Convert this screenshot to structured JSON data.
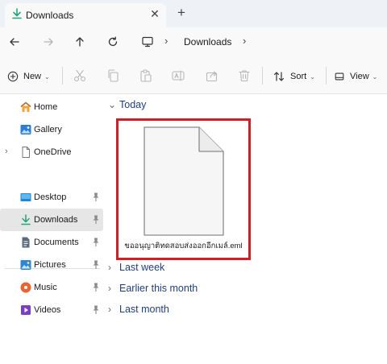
{
  "tab": {
    "title": "Downloads",
    "close_glyph": "✕",
    "new_tab_glyph": "+"
  },
  "navigation": {
    "back": "←",
    "forward": "→",
    "up": "↑",
    "refresh": "↻"
  },
  "address_bar": {
    "separator": "›",
    "path": "Downloads"
  },
  "toolbar": {
    "new_label": "New",
    "sort_label": "Sort",
    "view_label": "View",
    "caret": "⌄"
  },
  "sidebar": {
    "quick": [
      {
        "label": "Home",
        "icon": "home-icon"
      },
      {
        "label": "Gallery",
        "icon": "gallery-icon"
      },
      {
        "label": "OneDrive",
        "icon": "file-icon",
        "expand": "›"
      }
    ],
    "pinned": [
      {
        "label": "Desktop",
        "icon": "desktop-icon",
        "color": "#1e88d3"
      },
      {
        "label": "Downloads",
        "icon": "download-icon",
        "color": "#21a47a",
        "selected": true
      },
      {
        "label": "Documents",
        "icon": "documents-icon",
        "color": "#5b6b7c"
      },
      {
        "label": "Pictures",
        "icon": "pictures-icon",
        "color": "#2f86d6"
      },
      {
        "label": "Music",
        "icon": "music-icon",
        "color": "#e86534"
      },
      {
        "label": "Videos",
        "icon": "videos-icon",
        "color": "#7b3fc4"
      }
    ]
  },
  "content": {
    "groups": [
      {
        "label": "Today",
        "expanded": true
      },
      {
        "label": "Last week",
        "expanded": false
      },
      {
        "label": "Earlier this month",
        "expanded": false
      },
      {
        "label": "Last month",
        "expanded": false
      }
    ],
    "files": [
      {
        "name": "ขออนุญาติทดสอบส่งออกอีกเมล์.eml",
        "icon": "generic-file-icon",
        "highlighted": true
      }
    ]
  },
  "colors": {
    "highlight_border": "#d21d24",
    "group_header": "#1f3f7a",
    "selected_bg": "#e6e6e6"
  }
}
